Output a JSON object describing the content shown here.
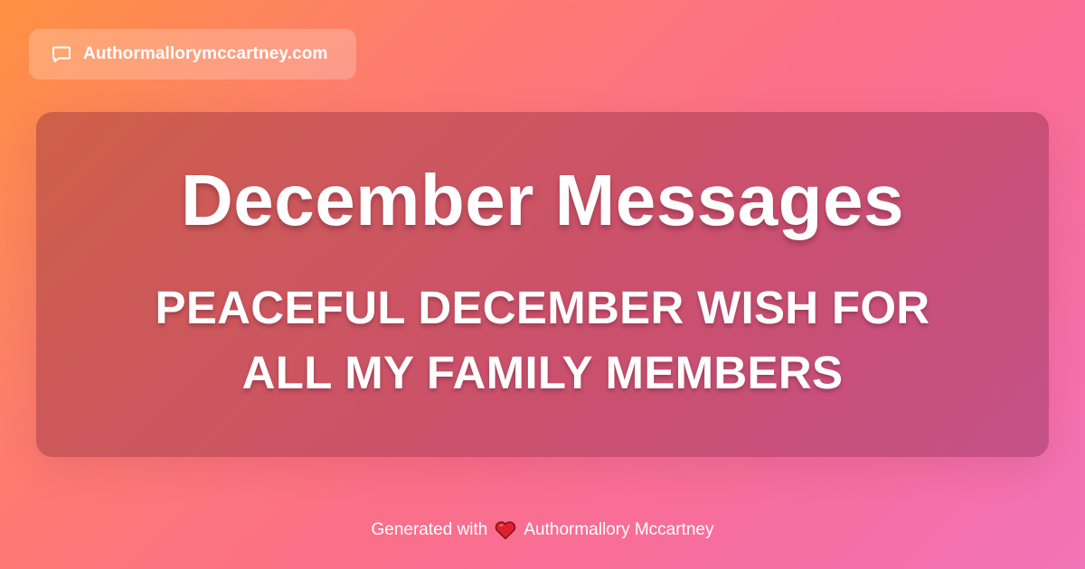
{
  "site": {
    "icon": "chat-bubble-icon",
    "label": "Authormallorymccartney.com"
  },
  "card": {
    "title": "December Messages",
    "subtitle": "PEACEFUL DECEMBER WISH FOR ALL MY FAMILY MEMBERS"
  },
  "footer": {
    "prefix": "Generated with",
    "icon": "heart-icon",
    "author": "Authormallory Mccartney"
  },
  "colors": {
    "gradient_start": "#ff9142",
    "gradient_end": "#f174b8",
    "heart": "#e0202e",
    "text": "#ffffff"
  }
}
